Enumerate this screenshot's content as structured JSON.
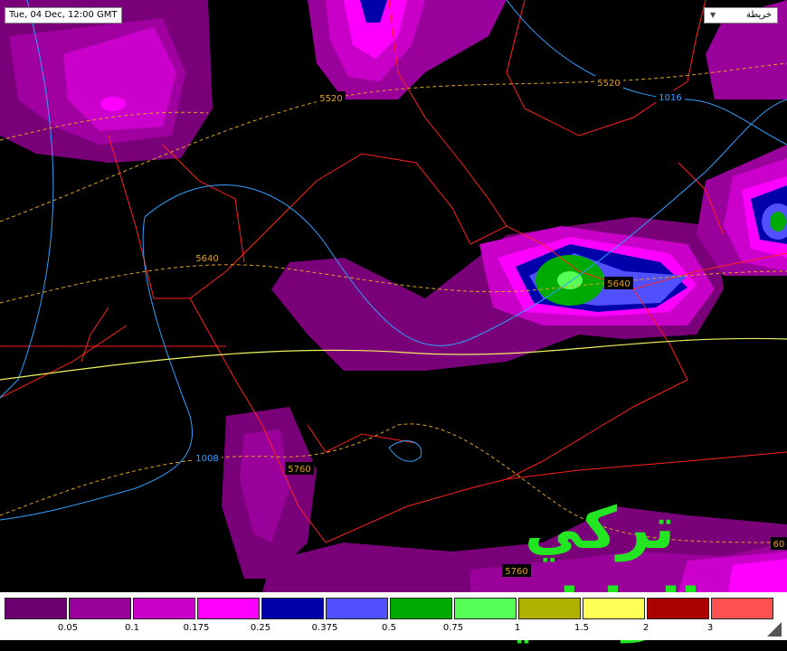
{
  "timestamp": "Tue, 04 Dec, 12:00 GMT",
  "layer_selector": {
    "selected": "خريطة",
    "icon": "dropdown-arrow-icon"
  },
  "watermark": "تركي الوايلي",
  "contour_labels": {
    "height_5520_a": "5520",
    "height_5520_b": "5520",
    "height_5640_a": "5640",
    "height_5640_b": "5640",
    "height_5760_a": "5760",
    "height_5760_b": "5760",
    "height_5760_c": "60",
    "pressure_1016": "1016",
    "pressure_1008": "1008"
  },
  "legend": {
    "colors": [
      "#6b0070",
      "#9a009a",
      "#c800c8",
      "#ff00ff",
      "#0000aa",
      "#5050ff",
      "#00aa00",
      "#55ff55",
      "#b0b000",
      "#ffff55",
      "#aa0000",
      "#ff5050"
    ],
    "ticks": [
      "0.05",
      "0.1",
      "0.175",
      "0.25",
      "0.375",
      "0.5",
      "0.75",
      "1",
      "1.5",
      "2",
      "3"
    ]
  }
}
